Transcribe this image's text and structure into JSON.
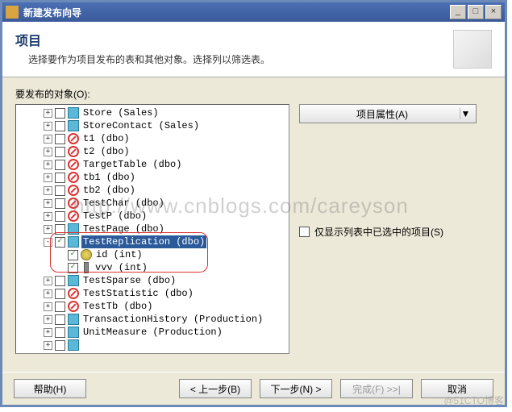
{
  "titlebar": {
    "title": "新建发布向导",
    "min": "_",
    "max": "□",
    "close": "×"
  },
  "header": {
    "title": "项目",
    "subtitle": "选择要作为项目发布的表和其他对象。选择列以筛选表。"
  },
  "labels": {
    "objects_to_publish": "要发布的对象(O):",
    "show_only_checked": "仅显示列表中已选中的项目(S)"
  },
  "right": {
    "properties_button": "项目属性(A)",
    "arrow": "▼"
  },
  "tree": {
    "nodes": [
      {
        "depth": 2,
        "expand": "+",
        "checked": false,
        "icon": "table",
        "label": "Store (Sales)"
      },
      {
        "depth": 2,
        "expand": "+",
        "checked": false,
        "icon": "table",
        "label": "StoreContact (Sales)"
      },
      {
        "depth": 2,
        "expand": "+",
        "checked": false,
        "icon": "blocked",
        "label": "t1 (dbo)"
      },
      {
        "depth": 2,
        "expand": "+",
        "checked": false,
        "icon": "blocked",
        "label": "t2 (dbo)"
      },
      {
        "depth": 2,
        "expand": "+",
        "checked": false,
        "icon": "blocked",
        "label": "TargetTable (dbo)"
      },
      {
        "depth": 2,
        "expand": "+",
        "checked": false,
        "icon": "blocked",
        "label": "tb1 (dbo)"
      },
      {
        "depth": 2,
        "expand": "+",
        "checked": false,
        "icon": "blocked",
        "label": "tb2 (dbo)"
      },
      {
        "depth": 2,
        "expand": "+",
        "checked": false,
        "icon": "blocked",
        "label": "TestChar (dbo)"
      },
      {
        "depth": 2,
        "expand": "+",
        "checked": false,
        "icon": "blocked",
        "label": "TestP (dbo)"
      },
      {
        "depth": 2,
        "expand": "+",
        "checked": false,
        "icon": "table",
        "label": "TestPage (dbo)"
      },
      {
        "depth": 2,
        "expand": "-",
        "checked": true,
        "icon": "table",
        "label": "TestReplication (dbo)",
        "selected": true
      },
      {
        "depth": 3,
        "expand": "",
        "checked": true,
        "icon": "col-pk",
        "label": "id (int)"
      },
      {
        "depth": 3,
        "expand": "",
        "checked": true,
        "icon": "col",
        "label": "vvv (int)"
      },
      {
        "depth": 2,
        "expand": "+",
        "checked": false,
        "icon": "table",
        "label": "TestSparse (dbo)"
      },
      {
        "depth": 2,
        "expand": "+",
        "checked": false,
        "icon": "blocked",
        "label": "TestStatistic (dbo)"
      },
      {
        "depth": 2,
        "expand": "+",
        "checked": false,
        "icon": "blocked",
        "label": "TestTb (dbo)"
      },
      {
        "depth": 2,
        "expand": "+",
        "checked": false,
        "icon": "table",
        "label": "TransactionHistory (Production)"
      },
      {
        "depth": 2,
        "expand": "+",
        "checked": false,
        "icon": "table",
        "label": "UnitMeasure (Production)"
      },
      {
        "depth": 2,
        "expand": "+",
        "checked": false,
        "icon": "table",
        "label": ""
      }
    ]
  },
  "footer": {
    "help": "帮助(H)",
    "back": "< 上一步(B)",
    "next": "下一步(N) >",
    "finish": "完成(F) >>|",
    "cancel": "取消"
  },
  "watermark": "http://www.cnblogs.com/careyson",
  "watermark2": "@51CTO博客"
}
